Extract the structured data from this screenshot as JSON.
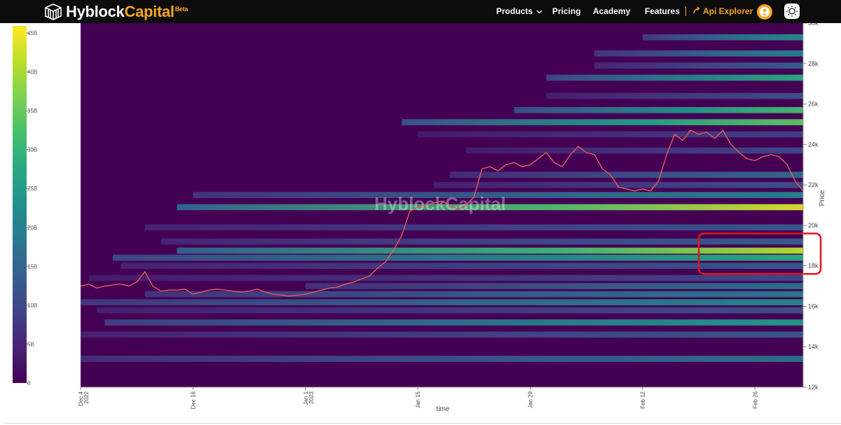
{
  "header": {
    "logo_text_white": "Hyblock",
    "logo_text_orange": "Capital",
    "logo_badge": "Beta",
    "nav": [
      {
        "label": "Products",
        "has_dropdown": true
      },
      {
        "label": "Pricing"
      },
      {
        "label": "Academy"
      },
      {
        "label": "Features"
      }
    ],
    "api_explorer": "Api Explorer",
    "icons": [
      "hyblock-logo-icon",
      "chevron-down-icon",
      "api-explorer-icon",
      "user-avatar-icon",
      "sun-icon"
    ],
    "colors": {
      "bar": "#0c0c0c",
      "accent": "#f5a623"
    }
  },
  "chart_data": {
    "type": "heatmap",
    "description_colors": "viridis",
    "watermark": "HyblockCapital",
    "xlabel": "time",
    "ylabel": "Price",
    "ylim": [
      12000,
      30000
    ],
    "x_ticks": [
      {
        "lines": [
          "Dec 4",
          "2022"
        ],
        "day": 0
      },
      {
        "lines": [
          "Dec 18"
        ],
        "day": 14
      },
      {
        "lines": [
          "Jan 1",
          "2023"
        ],
        "day": 28
      },
      {
        "lines": [
          "Jan 15"
        ],
        "day": 42
      },
      {
        "lines": [
          "Jan 29"
        ],
        "day": 56
      },
      {
        "lines": [
          "Feb 12"
        ],
        "day": 70
      },
      {
        "lines": [
          "Feb 26"
        ],
        "day": 84
      }
    ],
    "x_range_days": [
      0,
      90
    ],
    "y_ticks": [
      "12k",
      "14k",
      "16k",
      "18k",
      "20k",
      "22k",
      "24k",
      "26k",
      "28k",
      "30k"
    ],
    "y_tick_values": [
      12000,
      14000,
      16000,
      18000,
      20000,
      22000,
      24000,
      26000,
      28000,
      30000
    ],
    "colorbar": {
      "min": 0,
      "max": 45000000000,
      "ticks": [
        "0",
        "5B",
        "10B",
        "15B",
        "20B",
        "25B",
        "30B",
        "35B",
        "40B",
        "45B"
      ],
      "tick_values": [
        0,
        5,
        10,
        15,
        20,
        25,
        30,
        35,
        40,
        45
      ]
    },
    "price_series": [
      [
        0,
        17000
      ],
      [
        1,
        17100
      ],
      [
        2,
        16900
      ],
      [
        3,
        17000
      ],
      [
        4,
        17050
      ],
      [
        5,
        17100
      ],
      [
        6,
        17000
      ],
      [
        7,
        17200
      ],
      [
        8,
        17700
      ],
      [
        9,
        17000
      ],
      [
        10,
        16750
      ],
      [
        11,
        16800
      ],
      [
        12,
        16800
      ],
      [
        13,
        16850
      ],
      [
        14,
        16600
      ],
      [
        15,
        16700
      ],
      [
        16,
        16800
      ],
      [
        17,
        16850
      ],
      [
        18,
        16800
      ],
      [
        19,
        16750
      ],
      [
        20,
        16700
      ],
      [
        21,
        16750
      ],
      [
        22,
        16850
      ],
      [
        23,
        16700
      ],
      [
        24,
        16600
      ],
      [
        25,
        16550
      ],
      [
        26,
        16500
      ],
      [
        27,
        16550
      ],
      [
        28,
        16600
      ],
      [
        29,
        16700
      ],
      [
        30,
        16800
      ],
      [
        31,
        16900
      ],
      [
        32,
        16950
      ],
      [
        33,
        17100
      ],
      [
        34,
        17200
      ],
      [
        35,
        17350
      ],
      [
        36,
        17500
      ],
      [
        37,
        17900
      ],
      [
        38,
        18200
      ],
      [
        39,
        18800
      ],
      [
        40,
        19500
      ],
      [
        41,
        20700
      ],
      [
        42,
        20900
      ],
      [
        43,
        21000
      ],
      [
        44,
        21100
      ],
      [
        45,
        21200
      ],
      [
        46,
        21000
      ],
      [
        47,
        20800
      ],
      [
        48,
        21000
      ],
      [
        49,
        21400
      ],
      [
        50,
        22800
      ],
      [
        51,
        22900
      ],
      [
        52,
        22700
      ],
      [
        53,
        23000
      ],
      [
        54,
        23100
      ],
      [
        55,
        22900
      ],
      [
        56,
        23000
      ],
      [
        57,
        23300
      ],
      [
        58,
        23600
      ],
      [
        59,
        23100
      ],
      [
        60,
        22900
      ],
      [
        61,
        23500
      ],
      [
        62,
        23900
      ],
      [
        63,
        23600
      ],
      [
        64,
        23500
      ],
      [
        65,
        22800
      ],
      [
        66,
        22500
      ],
      [
        67,
        21900
      ],
      [
        68,
        21800
      ],
      [
        69,
        21700
      ],
      [
        70,
        21800
      ],
      [
        71,
        21700
      ],
      [
        72,
        22200
      ],
      [
        73,
        23500
      ],
      [
        74,
        24500
      ],
      [
        75,
        24200
      ],
      [
        76,
        24700
      ],
      [
        77,
        24500
      ],
      [
        78,
        24600
      ],
      [
        79,
        24300
      ],
      [
        80,
        24700
      ],
      [
        81,
        24000
      ],
      [
        82,
        23600
      ],
      [
        83,
        23300
      ],
      [
        84,
        23200
      ],
      [
        85,
        23400
      ],
      [
        86,
        23500
      ],
      [
        87,
        23400
      ],
      [
        88,
        23000
      ],
      [
        89,
        22200
      ],
      [
        90,
        21700
      ]
    ],
    "liquidation_bands": [
      {
        "price": 13400,
        "start_day": 0,
        "intensity": 0.38
      },
      {
        "price": 14600,
        "start_day": 0,
        "intensity": 0.28
      },
      {
        "price": 15200,
        "start_day": 3,
        "intensity": 0.55
      },
      {
        "price": 15800,
        "start_day": 2,
        "intensity": 0.25
      },
      {
        "price": 16200,
        "start_day": 0,
        "intensity": 0.48
      },
      {
        "price": 16600,
        "start_day": 8,
        "intensity": 0.42
      },
      {
        "price": 17000,
        "start_day": 28,
        "intensity": 0.38
      },
      {
        "price": 17400,
        "start_day": 1,
        "intensity": 0.22
      },
      {
        "price": 18000,
        "start_day": 5,
        "intensity": 0.28
      },
      {
        "price": 18400,
        "start_day": 4,
        "intensity": 0.62
      },
      {
        "price": 18750,
        "start_day": 12,
        "intensity": 0.9
      },
      {
        "price": 19200,
        "start_day": 10,
        "intensity": 0.3
      },
      {
        "price": 19900,
        "start_day": 8,
        "intensity": 0.28
      },
      {
        "price": 20900,
        "start_day": 12,
        "intensity": 0.95
      },
      {
        "price": 21500,
        "start_day": 14,
        "intensity": 0.45
      },
      {
        "price": 22000,
        "start_day": 44,
        "intensity": 0.25
      },
      {
        "price": 22500,
        "start_day": 46,
        "intensity": 0.35
      },
      {
        "price": 23700,
        "start_day": 48,
        "intensity": 0.22
      },
      {
        "price": 24500,
        "start_day": 42,
        "intensity": 0.2
      },
      {
        "price": 25100,
        "start_day": 40,
        "intensity": 0.75
      },
      {
        "price": 25700,
        "start_day": 54,
        "intensity": 0.7
      },
      {
        "price": 26400,
        "start_day": 58,
        "intensity": 0.25
      },
      {
        "price": 27300,
        "start_day": 58,
        "intensity": 0.62
      },
      {
        "price": 27900,
        "start_day": 64,
        "intensity": 0.3
      },
      {
        "price": 28500,
        "start_day": 64,
        "intensity": 0.45
      },
      {
        "price": 29300,
        "start_day": 70,
        "intensity": 0.5
      }
    ],
    "highlight": {
      "price_from": 17600,
      "price_to": 19600,
      "day_from": 77,
      "day_to": 90,
      "color": "#e0151b"
    }
  }
}
